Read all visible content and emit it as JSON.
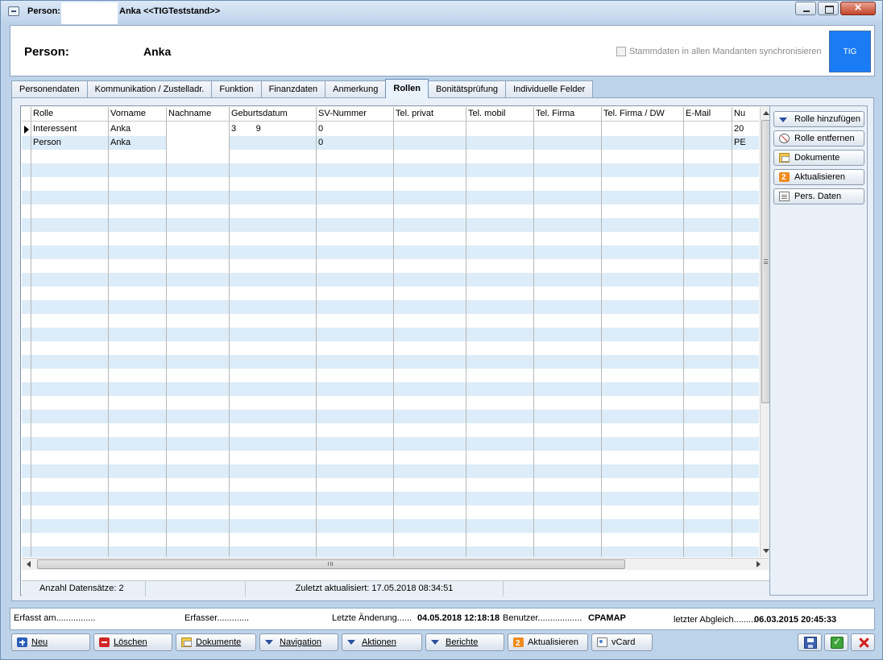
{
  "window": {
    "title_prefix": "Person:",
    "title_suffix": "Anka  <<TIGTeststand>>"
  },
  "header": {
    "label": "Person:",
    "name": "Anka",
    "sync_label": "Stammdaten in allen Mandanten synchronisieren",
    "sync_checked": false,
    "logo_text": "TIG"
  },
  "tabs": [
    {
      "label": "Personendaten",
      "active": false
    },
    {
      "label": "Kommunikation / Zustelladr.",
      "active": false
    },
    {
      "label": "Funktion",
      "active": false
    },
    {
      "label": "Finanzdaten",
      "active": false
    },
    {
      "label": "Anmerkung",
      "active": false
    },
    {
      "label": "Rollen",
      "active": true
    },
    {
      "label": "Bonitätsprüfung",
      "active": false
    },
    {
      "label": "Individuelle Felder",
      "active": false
    }
  ],
  "grid": {
    "columns": [
      "Rolle",
      "Vorname",
      "Nachname",
      "Geburtsdatum",
      "SV-Nummer",
      "Tel. privat",
      "Tel. mobil",
      "Tel. Firma",
      "Tel. Firma / DW",
      "E-Mail",
      "Nu"
    ],
    "rows": [
      [
        "Interessent",
        "Anka",
        "",
        "3        9",
        "0",
        "",
        "",
        "",
        "",
        "",
        "20"
      ],
      [
        "Person",
        "Anka",
        "",
        "",
        "0",
        "",
        "",
        "",
        "",
        "",
        "PE"
      ]
    ],
    "record_count": "Anzahl Datensätze: 2",
    "last_updated": "Zuletzt aktualisiert: 17.05.2018 08:34:51"
  },
  "side_buttons": [
    {
      "label": "Rolle hinzufügen",
      "icon": "chevron-down-icon"
    },
    {
      "label": "Rolle entfernen",
      "icon": "remove-role-icon"
    },
    {
      "label": "Dokumente",
      "icon": "folder-icon"
    },
    {
      "label": "Aktualisieren",
      "icon": "refresh-icon"
    },
    {
      "label": "Pers. Daten",
      "icon": "document-icon"
    }
  ],
  "info": {
    "erfasst_label": "Erfasst am................",
    "erfasser_label": "Erfasser.............",
    "letzte_aenderung_label": "Letzte Änderung......",
    "letzte_aenderung_value": "04.05.2018 12:18:18",
    "benutzer_label": "Benutzer..................",
    "benutzer_value": "CPAMAP",
    "abgleich_label": "letzter Abgleich.........",
    "abgleich_value": "06.03.2015 20:45:33"
  },
  "toolbar": {
    "neu": "Neu",
    "loeschen": "Löschen",
    "dokumente": "Dokumente",
    "navigation": "Navigation",
    "aktionen": "Aktionen",
    "berichte": "Berichte",
    "aktualisieren": "Aktualisieren",
    "vcard": "vCard"
  },
  "colors": {
    "accent_blue": "#1a7cf5",
    "row_alt": "#dcecf8",
    "delete_red": "#d12626",
    "ok_green": "#3fa43a"
  }
}
